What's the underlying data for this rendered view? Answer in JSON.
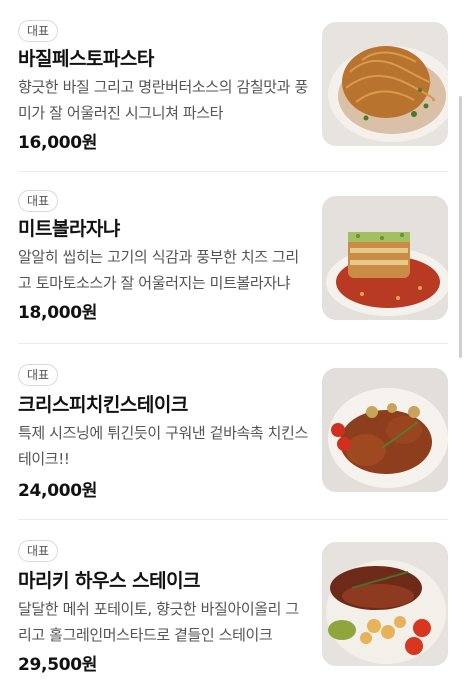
{
  "badge_label": "대표",
  "items": [
    {
      "name": "바질페스토파스타",
      "description": "향긋한 바질 그리고 명란버터소스의 감칠맛과 풍미가 잘 어울러진 시그니쳐 파스타",
      "price": "16,000원",
      "image_icon": "pasta-photo"
    },
    {
      "name": "미트볼라자냐",
      "description": "알알히 씹히는 고기의 식감과 풍부한 치즈 그리고 토마토소스가 잘 어울러지는 미트볼라자냐",
      "price": "18,000원",
      "image_icon": "lasagna-photo"
    },
    {
      "name": "크리스피치킨스테이크",
      "description": "특제 시즈닝에 튀긴듯이 구워낸 겉바속촉 치킨스테이크!!",
      "price": "24,000원",
      "image_icon": "chicken-steak-photo"
    },
    {
      "name": "마리키 하우스 스테이크",
      "description": "달달한 메쉬 포테이토, 향긋한 바질아이올리 그리고 홀그레인머스타드로 곁들인 스테이크",
      "price": "29,500원",
      "image_icon": "steak-photo"
    }
  ]
}
